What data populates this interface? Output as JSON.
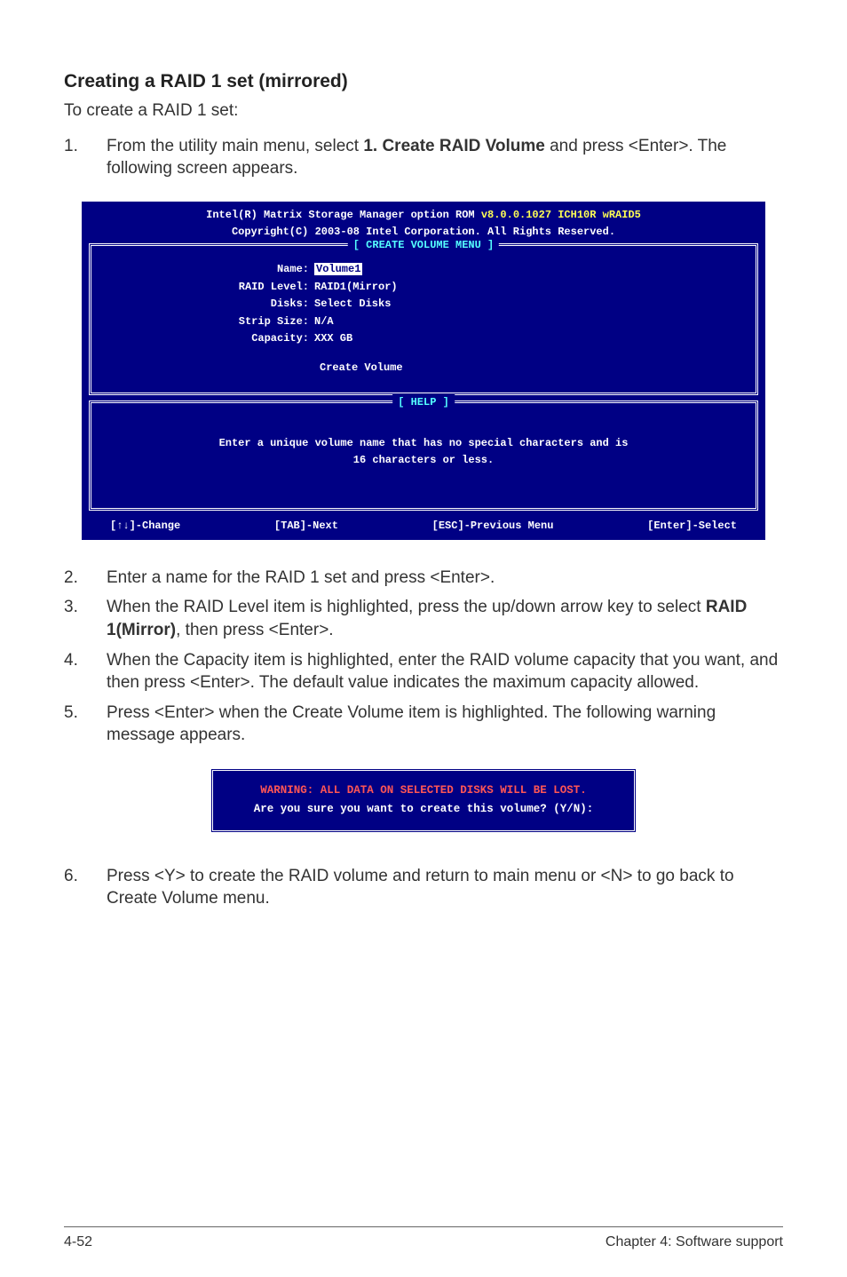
{
  "heading": "Creating a RAID 1 set (mirrored)",
  "intro": "To create a RAID 1 set:",
  "steps_a": [
    {
      "n": "1.",
      "pre": "From the utility main menu, select ",
      "bold": "1. Create RAID Volume",
      "post": " and press <Enter>. The following screen appears."
    }
  ],
  "bios": {
    "title_line1a": "Intel(R) Matrix Storage Manager option ROM ",
    "title_line1b": "v8.0.0.1027 ICH10R wRAID5",
    "title_line2": "Copyright(C) 2003-08 Intel Corporation. All Rights Reserved.",
    "create_menu_title": "[ CREATE VOLUME MENU ]",
    "fields": {
      "name_label": "Name:",
      "name_value": "Volume1",
      "raid_label": "RAID Level:",
      "raid_value": "RAID1(Mirror)",
      "disks_label": "Disks:",
      "disks_value": "Select Disks",
      "strip_label": "Strip Size:",
      "strip_value": "N/A",
      "cap_label": "Capacity:",
      "cap_value": "XXX  GB"
    },
    "create_volume": "Create Volume",
    "help_title": "[ HELP ]",
    "help_text1": "Enter a unique volume name that has no special characters and is",
    "help_text2": "16 characters or less.",
    "footer": {
      "change": "[↑↓]-Change",
      "tab": "[TAB]-Next",
      "esc": "[ESC]-Previous Menu",
      "enter": "[Enter]-Select"
    }
  },
  "steps_b": [
    {
      "n": "2.",
      "text": "Enter a name for the RAID 1 set and press <Enter>."
    },
    {
      "n": "3.",
      "pre": "When the RAID Level item is highlighted, press the up/down arrow key to select ",
      "bold": "RAID 1(Mirror)",
      "post": ", then press <Enter>."
    },
    {
      "n": "4.",
      "text": "When the Capacity item is highlighted, enter the RAID volume capacity that you want, and then press <Enter>. The default value indicates the maximum capacity allowed."
    },
    {
      "n": "5.",
      "text": "Press <Enter> when the Create Volume item is highlighted. The following warning message appears."
    }
  ],
  "dialog": {
    "warn": "WARNING: ALL DATA ON SELECTED DISKS WILL BE LOST.",
    "confirm": "Are you sure you want to create this volume? (Y/N):"
  },
  "steps_c": [
    {
      "n": "6.",
      "text": "Press <Y> to create the RAID volume and return to main menu or <N> to go back to Create Volume menu."
    }
  ],
  "footer": {
    "left": "4-52",
    "right": "Chapter 4: Software support"
  }
}
